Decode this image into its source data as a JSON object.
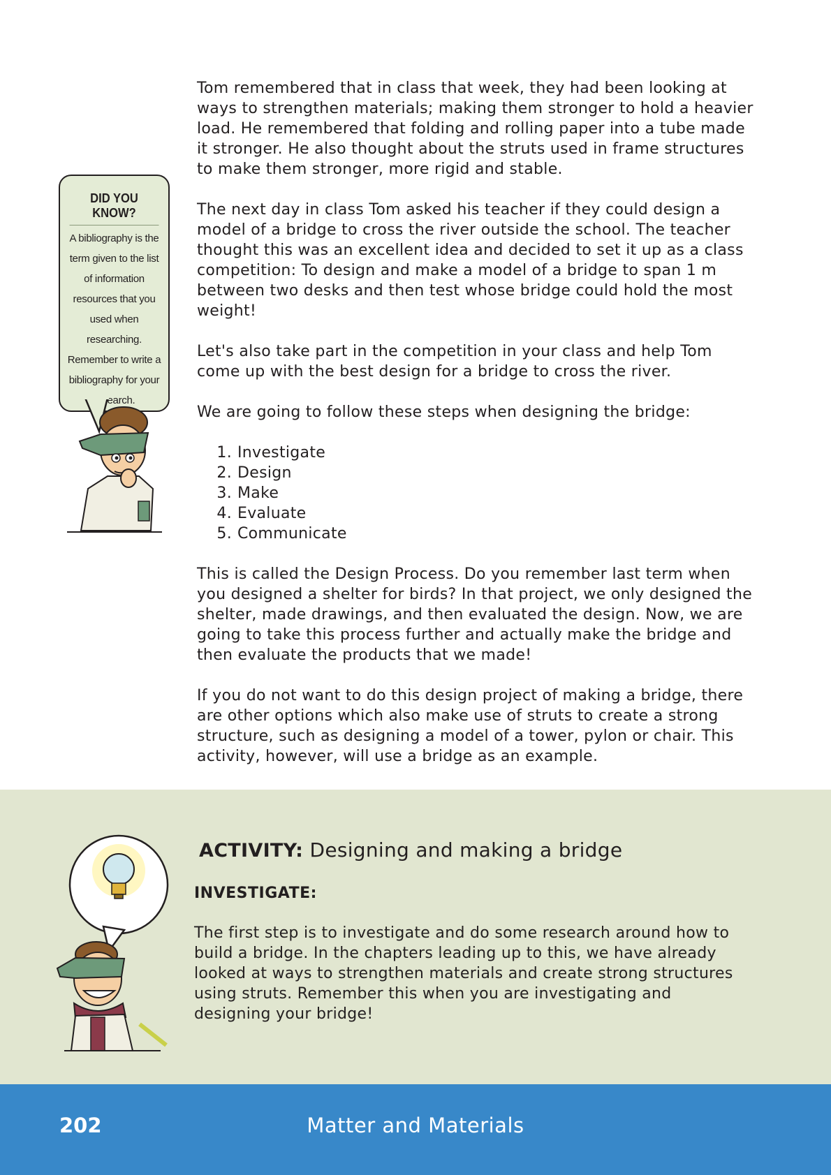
{
  "body": {
    "paragraphs_top": [
      "Tom remembered that in class that week, they had been looking at ways to strengthen materials; making them stronger to hold a heavier load. He remembered that folding and rolling paper into a tube made it stronger. He also thought about the struts used in frame structures to make them stronger, more rigid and stable.",
      "The next day in class Tom asked his teacher if they could design a model of a bridge to cross the river outside the school. The teacher thought this was an excellent idea and decided to set it up as a class competition: To design and make a model of a bridge to span 1 m between two desks and then test whose bridge could hold the most weight!",
      "Let's also take part in the competition in your class and help Tom come up with the best design for a bridge to cross the river.",
      "We are going to follow these steps when designing the bridge:"
    ],
    "steps": [
      {
        "num": "1.",
        "label": "Investigate"
      },
      {
        "num": "2.",
        "label": "Design"
      },
      {
        "num": "3.",
        "label": "Make"
      },
      {
        "num": "4.",
        "label": "Evaluate"
      },
      {
        "num": "5.",
        "label": "Communicate"
      }
    ],
    "paragraphs_bottom": [
      "This is called the Design Process. Do you remember last term when you designed a shelter for birds? In that project, we only designed the shelter, made drawings, and then evaluated the design. Now, we are going to take this process further and actually make the bridge and then evaluate the products that we made!",
      "If you do not want to do this design project of making a bridge, there are other options which also make use of struts to create a strong structure, such as designing a model of a tower, pylon or chair. This activity, however, will use a bridge as an example."
    ]
  },
  "did_you_know": {
    "title": "DID YOU KNOW?",
    "text": "A bibliography is the term given to the list of information resources that you used when researching. Remember to write a bibliography for your research."
  },
  "activity": {
    "label": "ACTIVITY:",
    "title": "Designing and making a bridge",
    "subheading": "INVESTIGATE:",
    "text": "The first step is to investigate and do some research around how to build a bridge. In the chapters leading up to this, we have already looked at ways to strengthen materials and create strong structures using struts. Remember this when you are investigating and designing your bridge!"
  },
  "footer": {
    "page_number": "202",
    "title": "Matter and Materials"
  },
  "colors": {
    "activity_bg": "#e1e6d0",
    "footer_bg": "#3888c9",
    "callout_bg": "#e4ecd6"
  },
  "icons": [
    "thinking-boy-icon",
    "lightbulb-icon",
    "smiling-boy-icon"
  ]
}
